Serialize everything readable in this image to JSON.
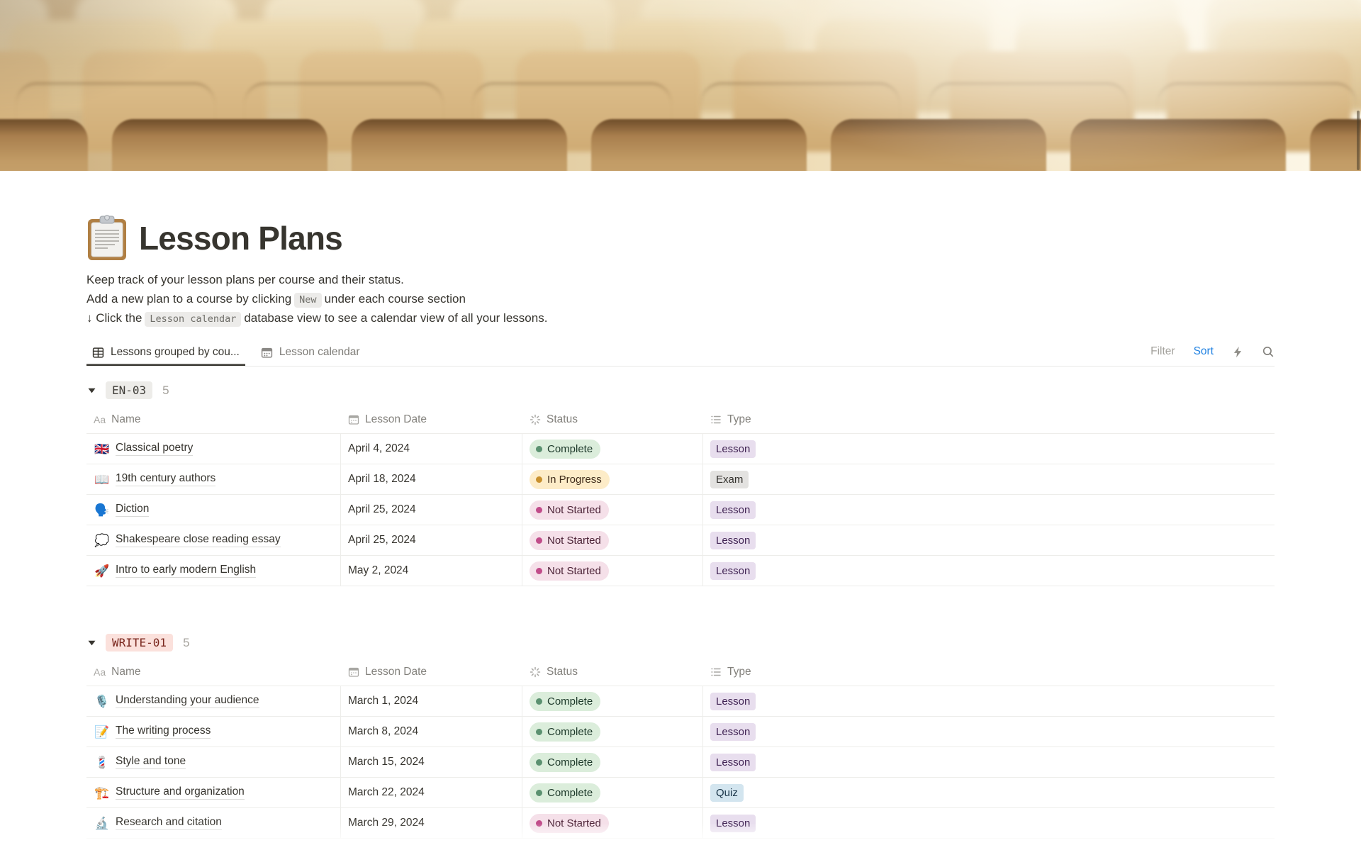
{
  "page": {
    "icon": "📋",
    "title": "Lesson Plans",
    "description": {
      "line1": "Keep track of your lesson plans per course and their status.",
      "line2_before": "Add a new plan to a course by clicking",
      "line2_chip": "New",
      "line2_after": "under each course section",
      "line3_before": "↓ Click the",
      "line3_chip": "Lesson calendar",
      "line3_after": "database view to see a calendar view of all your lessons."
    }
  },
  "views": {
    "tabs": [
      {
        "icon": "table-icon",
        "label": "Lessons grouped by cou...",
        "active": true
      },
      {
        "icon": "calendar-icon",
        "label": "Lesson calendar",
        "active": false
      }
    ],
    "toolbar": {
      "filter": "Filter",
      "sort": "Sort",
      "icons": [
        "lightning-icon",
        "search-icon"
      ]
    }
  },
  "table": {
    "columns": [
      {
        "icon": "text-icon",
        "icon_glyph": "Aa",
        "label": "Name"
      },
      {
        "icon": "calendar-icon",
        "label": "Lesson Date"
      },
      {
        "icon": "status-spinner-icon",
        "label": "Status"
      },
      {
        "icon": "list-icon",
        "label": "Type"
      }
    ]
  },
  "colors": {
    "accent_blue": "#2383e2",
    "status_complete_bg": "#dbeddb",
    "status_in_progress_bg": "#fdecc8",
    "status_not_started_bg": "#f5e0e9",
    "type_lesson_bg": "#e8deee",
    "type_exam_bg": "#e3e2e0",
    "type_quiz_bg": "#d3e5ef",
    "group_en03_bg": "#edece9",
    "group_write01_bg": "#fbe1dc"
  },
  "groups": [
    {
      "name": "EN-03",
      "color": "gray",
      "count": "5",
      "rows": [
        {
          "icon": "🇬🇧",
          "name": "Classical poetry",
          "date": "April 4, 2024",
          "status": {
            "label": "Complete",
            "color": "green"
          },
          "type": {
            "label": "Lesson",
            "color": "purple"
          }
        },
        {
          "icon": "📖",
          "name": "19th century authors",
          "date": "April 18, 2024",
          "status": {
            "label": "In Progress",
            "color": "yellow"
          },
          "type": {
            "label": "Exam",
            "color": "gray"
          }
        },
        {
          "icon": "🗣️",
          "name": "Diction",
          "date": "April 25, 2024",
          "status": {
            "label": "Not Started",
            "color": "pink"
          },
          "type": {
            "label": "Lesson",
            "color": "purple"
          }
        },
        {
          "icon": "💭",
          "name": "Shakespeare close reading essay",
          "date": "April 25, 2024",
          "status": {
            "label": "Not Started",
            "color": "pink"
          },
          "type": {
            "label": "Lesson",
            "color": "purple"
          }
        },
        {
          "icon": "🚀",
          "name": "Intro to early modern English",
          "date": "May 2, 2024",
          "status": {
            "label": "Not Started",
            "color": "pink"
          },
          "type": {
            "label": "Lesson",
            "color": "purple"
          }
        }
      ]
    },
    {
      "name": "WRITE-01",
      "color": "red",
      "count": "5",
      "rows": [
        {
          "icon": "🎙️",
          "name": "Understanding your audience",
          "date": "March 1, 2024",
          "status": {
            "label": "Complete",
            "color": "green"
          },
          "type": {
            "label": "Lesson",
            "color": "purple"
          }
        },
        {
          "icon": "📝",
          "name": "The writing process",
          "date": "March 8, 2024",
          "status": {
            "label": "Complete",
            "color": "green"
          },
          "type": {
            "label": "Lesson",
            "color": "purple"
          }
        },
        {
          "icon": "💈",
          "name": "Style and tone",
          "date": "March 15, 2024",
          "status": {
            "label": "Complete",
            "color": "green"
          },
          "type": {
            "label": "Lesson",
            "color": "purple"
          }
        },
        {
          "icon": "🏗️",
          "name": "Structure and organization",
          "date": "March 22, 2024",
          "status": {
            "label": "Complete",
            "color": "green"
          },
          "type": {
            "label": "Quiz",
            "color": "blue"
          }
        },
        {
          "icon": "🔬",
          "name": "Research and citation",
          "date": "March 29, 2024",
          "status": {
            "label": "Not Started",
            "color": "pink"
          },
          "type": {
            "label": "Lesson",
            "color": "purple"
          }
        }
      ]
    }
  ]
}
